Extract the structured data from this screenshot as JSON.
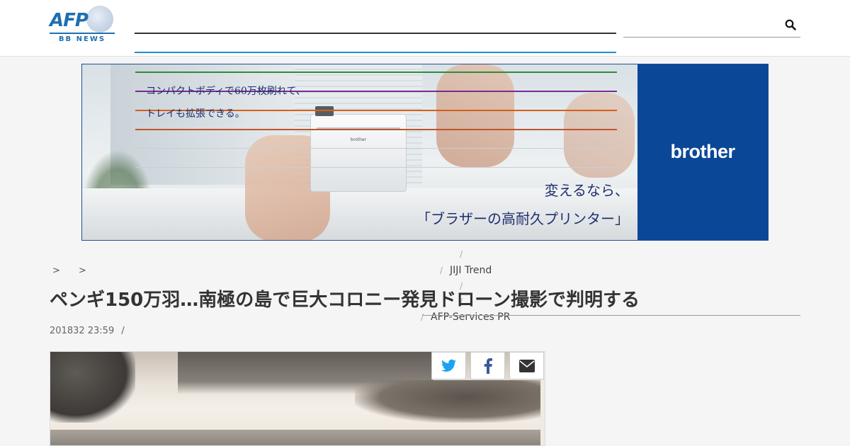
{
  "header": {
    "logo_text": "AFP",
    "logo_sub": "BB NEWS",
    "search": {
      "value": "",
      "placeholder": ""
    }
  },
  "ad": {
    "copy_line1": "コンパクトボディで60万枚刷れて、",
    "copy_line2": "トレイも拡張できる。",
    "headline_line1": "変えるなら、",
    "headline_line2": "「ブラザーの高耐久プリンター」",
    "brand": "brother",
    "printer_brand": "brother",
    "nav_colors": [
      "#2e8b3a",
      "#7a2a93",
      "#d4601a",
      "#c0552a"
    ]
  },
  "nav": {
    "items": [
      "JIJI Trend",
      "AFP-Services PR"
    ]
  },
  "breadcrumb": [
    ">",
    ">"
  ],
  "article": {
    "title": "ペンギ150万羽…南極の島で巨大コロニー発見ドローン撮影で判明する",
    "date": "201832 23:59",
    "date_sep": "/"
  },
  "share": {
    "twitter": "twitter-icon",
    "facebook": "facebook-icon",
    "email": "email-icon"
  },
  "colors": {
    "accent": "#1f8ec9",
    "brand_blue": "#0a4797",
    "afp_blue": "#1f6fb2"
  }
}
